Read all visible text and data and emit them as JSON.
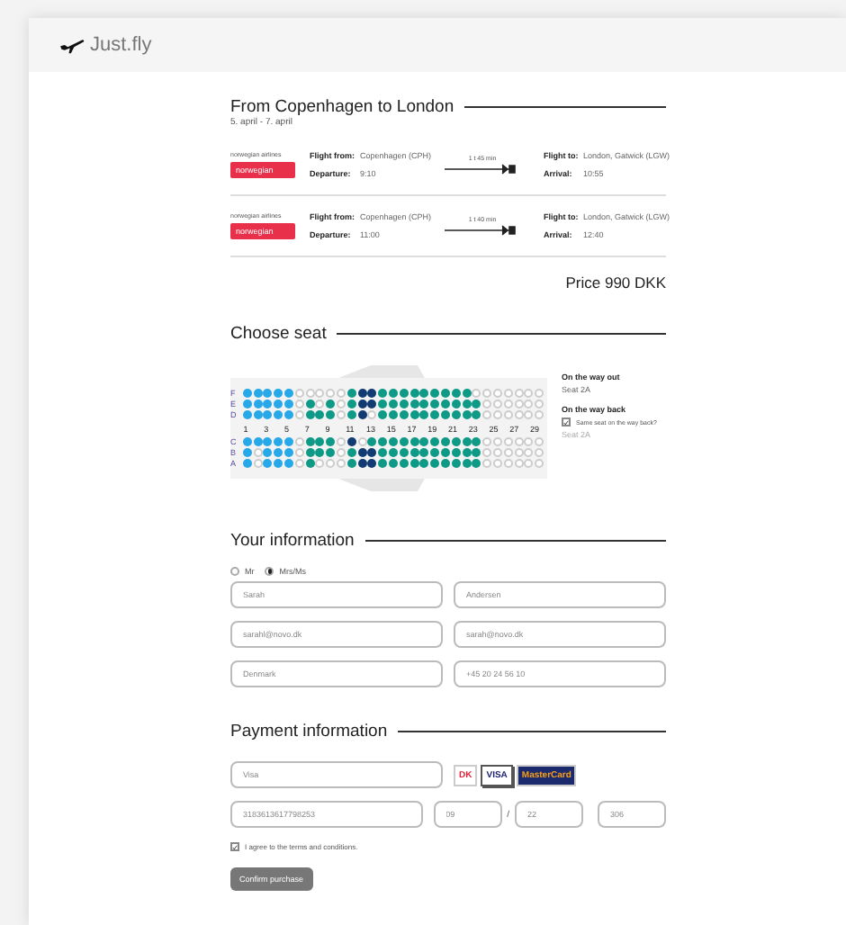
{
  "app": {
    "brand": "Just.fly"
  },
  "trip": {
    "title": "From Copenhagen to London",
    "dates": "5. april - 7. april",
    "flights": [
      {
        "airline_caption": "norwegian airlines",
        "airline_logo": "norwegian",
        "from_label": "Flight from:",
        "from": "Copenhagen (CPH)",
        "dep_label": "Departure:",
        "departure": "9:10",
        "duration": "1 t 45 min",
        "to_label": "Flight to:",
        "to": "London, Gatwick (LGW)",
        "arr_label": "Arrival:",
        "arrival": "10:55"
      },
      {
        "airline_caption": "norwegian airlines",
        "airline_logo": "norwegian",
        "from_label": "Flight from:",
        "from": "Copenhagen (CPH)",
        "dep_label": "Departure:",
        "departure": "11:00",
        "duration": "1 t 40 min",
        "to_label": "Flight to:",
        "to": "London, Gatwick (LGW)",
        "arr_label": "Arrival:",
        "arrival": "12:40"
      }
    ],
    "price": "Price 990 DKK"
  },
  "seat_map": {
    "title": "Choose seat",
    "rows_top": [
      {
        "letter": "F",
        "seats": [
          {
            "kind": "front"
          },
          {
            "kind": "front"
          },
          {
            "kind": "front"
          },
          {
            "kind": "front"
          },
          {
            "kind": "front"
          },
          {
            "kind": "free"
          },
          {
            "kind": "free"
          },
          {
            "kind": "free"
          },
          {
            "kind": "free"
          },
          {
            "kind": "free"
          },
          {
            "kind": "std"
          },
          {
            "kind": "taken"
          },
          {
            "kind": "taken"
          },
          {
            "kind": "std"
          },
          {
            "kind": "std"
          },
          {
            "kind": "std"
          },
          {
            "kind": "std"
          },
          {
            "kind": "std"
          },
          {
            "kind": "std"
          },
          {
            "kind": "std"
          },
          {
            "kind": "std"
          },
          {
            "kind": "std"
          },
          {
            "kind": "free"
          },
          {
            "kind": "free"
          },
          {
            "kind": "free"
          },
          {
            "kind": "free"
          },
          {
            "kind": "free"
          },
          {
            "kind": "free"
          },
          {
            "kind": "free"
          }
        ]
      },
      {
        "letter": "E",
        "seats": [
          {
            "kind": "front"
          },
          {
            "kind": "front"
          },
          {
            "kind": "front"
          },
          {
            "kind": "front"
          },
          {
            "kind": "front"
          },
          {
            "kind": "free"
          },
          {
            "kind": "std"
          },
          {
            "kind": "free"
          },
          {
            "kind": "std"
          },
          {
            "kind": "free"
          },
          {
            "kind": "std"
          },
          {
            "kind": "taken"
          },
          {
            "kind": "taken"
          },
          {
            "kind": "std"
          },
          {
            "kind": "std"
          },
          {
            "kind": "std"
          },
          {
            "kind": "std"
          },
          {
            "kind": "std"
          },
          {
            "kind": "std"
          },
          {
            "kind": "std"
          },
          {
            "kind": "std"
          },
          {
            "kind": "std"
          },
          {
            "kind": "std"
          },
          {
            "kind": "free"
          },
          {
            "kind": "free"
          },
          {
            "kind": "free"
          },
          {
            "kind": "free"
          },
          {
            "kind": "free"
          },
          {
            "kind": "free"
          }
        ]
      },
      {
        "letter": "D",
        "seats": [
          {
            "kind": "front"
          },
          {
            "kind": "front"
          },
          {
            "kind": "front"
          },
          {
            "kind": "front"
          },
          {
            "kind": "front"
          },
          {
            "kind": "free"
          },
          {
            "kind": "std"
          },
          {
            "kind": "std"
          },
          {
            "kind": "std"
          },
          {
            "kind": "free"
          },
          {
            "kind": "std"
          },
          {
            "kind": "taken"
          },
          {
            "kind": "free"
          },
          {
            "kind": "std"
          },
          {
            "kind": "std"
          },
          {
            "kind": "std"
          },
          {
            "kind": "std"
          },
          {
            "kind": "std"
          },
          {
            "kind": "std"
          },
          {
            "kind": "std"
          },
          {
            "kind": "std"
          },
          {
            "kind": "std"
          },
          {
            "kind": "std"
          },
          {
            "kind": "free"
          },
          {
            "kind": "free"
          },
          {
            "kind": "free"
          },
          {
            "kind": "free"
          },
          {
            "kind": "free"
          },
          {
            "kind": "free"
          }
        ]
      }
    ],
    "numbers": [
      "1",
      "3",
      "5",
      "7",
      "9",
      "11",
      "13",
      "15",
      "17",
      "19",
      "21",
      "23",
      "25",
      "27",
      "29"
    ],
    "rows_bottom": [
      {
        "letter": "C",
        "seats": [
          {
            "kind": "front"
          },
          {
            "kind": "front"
          },
          {
            "kind": "front"
          },
          {
            "kind": "front"
          },
          {
            "kind": "front"
          },
          {
            "kind": "free"
          },
          {
            "kind": "std"
          },
          {
            "kind": "std"
          },
          {
            "kind": "std"
          },
          {
            "kind": "free"
          },
          {
            "kind": "taken"
          },
          {
            "kind": "free"
          },
          {
            "kind": "std"
          },
          {
            "kind": "std"
          },
          {
            "kind": "std"
          },
          {
            "kind": "std"
          },
          {
            "kind": "std"
          },
          {
            "kind": "std"
          },
          {
            "kind": "std"
          },
          {
            "kind": "std"
          },
          {
            "kind": "std"
          },
          {
            "kind": "std"
          },
          {
            "kind": "std"
          },
          {
            "kind": "free"
          },
          {
            "kind": "free"
          },
          {
            "kind": "free"
          },
          {
            "kind": "free"
          },
          {
            "kind": "free"
          },
          {
            "kind": "free"
          }
        ]
      },
      {
        "letter": "B",
        "seats": [
          {
            "kind": "front"
          },
          {
            "kind": "free"
          },
          {
            "kind": "front"
          },
          {
            "kind": "front"
          },
          {
            "kind": "front"
          },
          {
            "kind": "free"
          },
          {
            "kind": "std"
          },
          {
            "kind": "std"
          },
          {
            "kind": "std"
          },
          {
            "kind": "free"
          },
          {
            "kind": "std"
          },
          {
            "kind": "taken"
          },
          {
            "kind": "taken"
          },
          {
            "kind": "std"
          },
          {
            "kind": "std"
          },
          {
            "kind": "std"
          },
          {
            "kind": "std"
          },
          {
            "kind": "std"
          },
          {
            "kind": "std"
          },
          {
            "kind": "std"
          },
          {
            "kind": "std"
          },
          {
            "kind": "std"
          },
          {
            "kind": "std"
          },
          {
            "kind": "free"
          },
          {
            "kind": "free"
          },
          {
            "kind": "free"
          },
          {
            "kind": "free"
          },
          {
            "kind": "free"
          },
          {
            "kind": "free"
          }
        ]
      },
      {
        "letter": "A",
        "seats": [
          {
            "kind": "front"
          },
          {
            "kind": "free"
          },
          {
            "kind": "front"
          },
          {
            "kind": "front"
          },
          {
            "kind": "front"
          },
          {
            "kind": "free"
          },
          {
            "kind": "std"
          },
          {
            "kind": "free"
          },
          {
            "kind": "free"
          },
          {
            "kind": "free"
          },
          {
            "kind": "std"
          },
          {
            "kind": "taken"
          },
          {
            "kind": "taken"
          },
          {
            "kind": "std"
          },
          {
            "kind": "std"
          },
          {
            "kind": "std"
          },
          {
            "kind": "std"
          },
          {
            "kind": "std"
          },
          {
            "kind": "std"
          },
          {
            "kind": "std"
          },
          {
            "kind": "std"
          },
          {
            "kind": "std"
          },
          {
            "kind": "std"
          },
          {
            "kind": "free"
          },
          {
            "kind": "free"
          },
          {
            "kind": "free"
          },
          {
            "kind": "free"
          },
          {
            "kind": "free"
          },
          {
            "kind": "free"
          }
        ]
      }
    ],
    "out_label": "On the way out",
    "out_seat": "Seat 2A",
    "back_label": "On the way back",
    "same_seat": {
      "label": "Same seat on the way back?",
      "checked": true
    },
    "back_seat": "Seat 2A"
  },
  "your_info": {
    "title": "Your information",
    "salutations": [
      {
        "label": "Mr",
        "selected": false
      },
      {
        "label": "Mrs/Ms",
        "selected": true
      }
    ],
    "fields": [
      {
        "placeholder": "Sarah"
      },
      {
        "placeholder": "Andersen"
      },
      {
        "placeholder": "sarahl@novo.dk"
      },
      {
        "placeholder": "sarah@novo.dk"
      },
      {
        "placeholder": "Denmark"
      },
      {
        "placeholder": "+45 20 24 56 10"
      }
    ]
  },
  "payment": {
    "title": "Payment information",
    "card_type": {
      "placeholder": "Visa"
    },
    "cards": [
      {
        "label": "DK",
        "kind": "dankort",
        "selected": false
      },
      {
        "label": "VISA",
        "kind": "visa",
        "selected": true
      },
      {
        "label": "MasterCard",
        "kind": "mastercard",
        "selected": false
      }
    ],
    "card_number": {
      "placeholder": "3183613617798253"
    },
    "month": {
      "placeholder": "09"
    },
    "separator": "/",
    "year": {
      "placeholder": "22"
    },
    "cvc": {
      "placeholder": "306"
    },
    "terms": {
      "label": "I agree to the terms and conditions.",
      "checked": true
    },
    "submit": "Confirm purchase"
  }
}
